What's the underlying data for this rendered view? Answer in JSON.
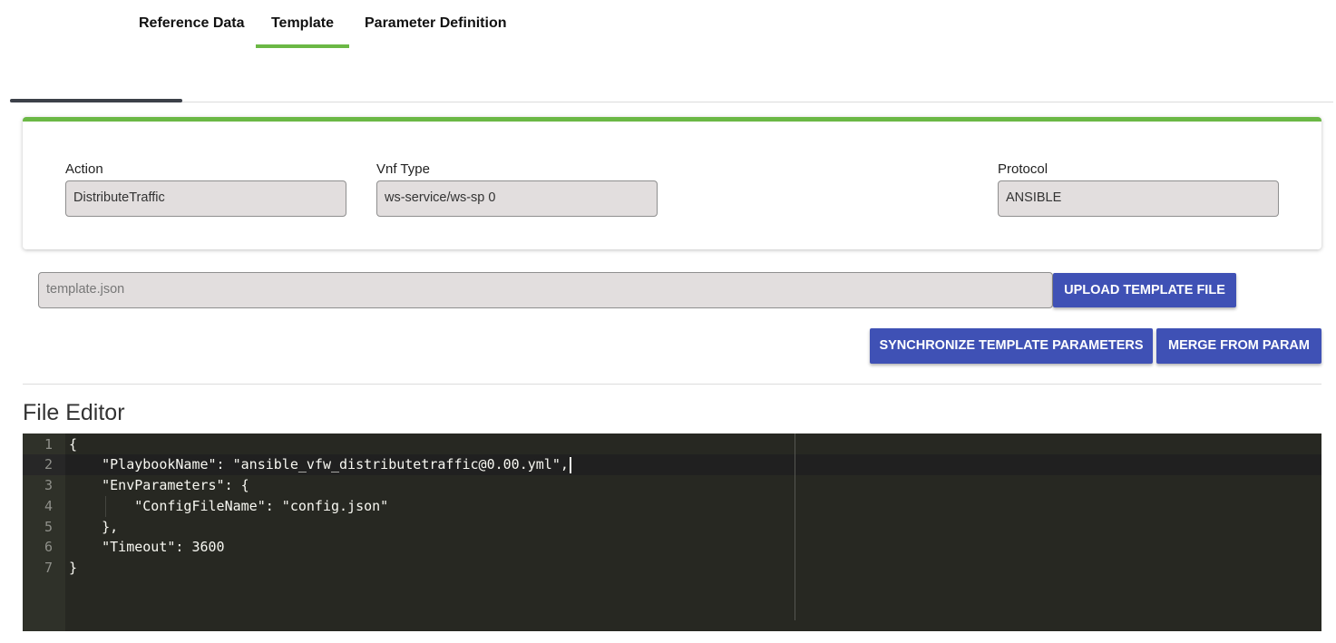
{
  "tabs": [
    {
      "label": "Reference Data",
      "active": false
    },
    {
      "label": "Template",
      "active": true
    },
    {
      "label": "Parameter Definition",
      "active": false
    }
  ],
  "progress": 0.13,
  "form": {
    "action_label": "Action",
    "action_value": "DistributeTraffic",
    "vnf_label": "Vnf Type",
    "vnf_value": "ws-service/ws-sp 0",
    "protocol_label": "Protocol",
    "protocol_value": "ANSIBLE"
  },
  "upload": {
    "file_placeholder": "template.json",
    "upload_label": "Upload Template File"
  },
  "actions": {
    "sync_label": "Synchronize Template Parameters",
    "merge_label": "Merge from Param"
  },
  "editor": {
    "title": "File Editor",
    "lines": [
      {
        "num": "1",
        "text": "{"
      },
      {
        "num": "2",
        "text": "    \"PlaybookName\": \"ansible_vfw_distributetraffic@0.00.yml\","
      },
      {
        "num": "3",
        "text": "    \"EnvParameters\": {"
      },
      {
        "num": "4",
        "text": "        \"ConfigFileName\": \"config.json\""
      },
      {
        "num": "5",
        "text": "    },"
      },
      {
        "num": "6",
        "text": "    \"Timeout\": 3600"
      },
      {
        "num": "7",
        "text": "}"
      }
    ]
  },
  "colors": {
    "accent_green": "#6bb845",
    "button_blue": "#3f51b5",
    "editor_bg": "#272822"
  }
}
